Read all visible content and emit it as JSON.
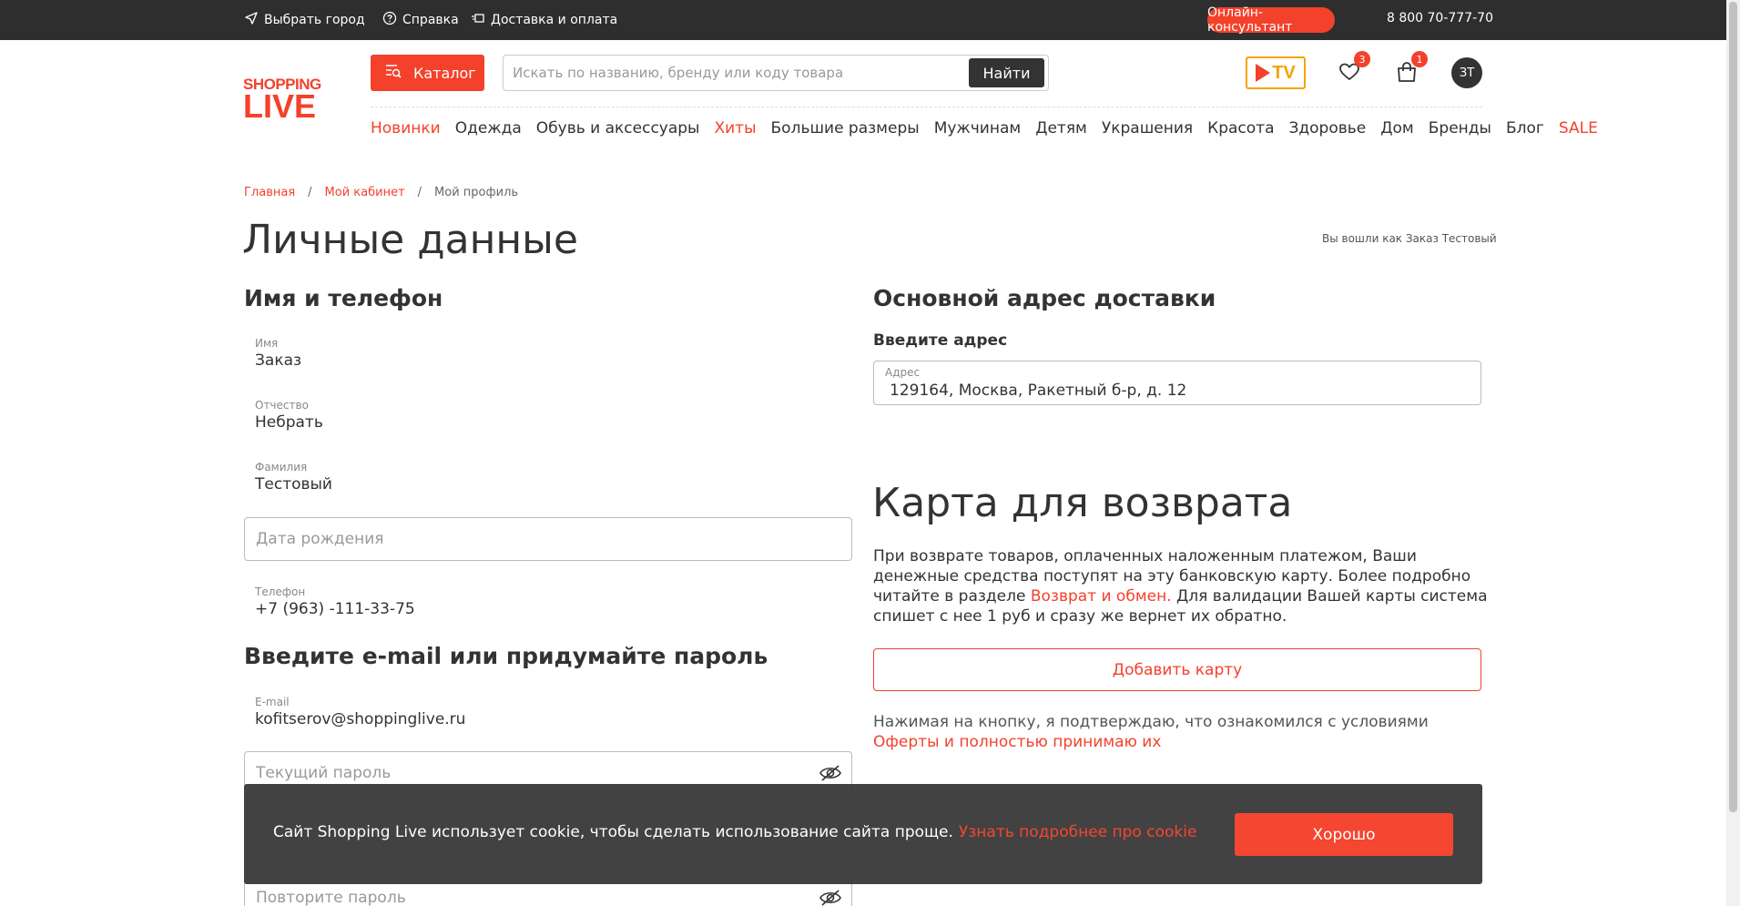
{
  "topbar": {
    "city_label": "Выбрать город",
    "help_label": "Справка",
    "delivery_label": "Доставка и оплата",
    "consultant_label": "Онлайн-консультант",
    "phone": "8 800 70-777-70"
  },
  "header": {
    "logo_top": "SHOPPING",
    "logo_bottom": "LIVE",
    "catalog_label": "Каталог",
    "search_placeholder": "Искать по названию, бренду или коду товара",
    "search_button": "Найти",
    "tv_label": "TV",
    "favorites_count": "3",
    "cart_count": "1",
    "avatar_initials": "ЗТ"
  },
  "nav": [
    {
      "label": "Новинки",
      "accent": true
    },
    {
      "label": "Одежда",
      "accent": false
    },
    {
      "label": "Обувь и аксессуары",
      "accent": false
    },
    {
      "label": "Хиты",
      "accent": true
    },
    {
      "label": "Большие размеры",
      "accent": false
    },
    {
      "label": "Мужчинам",
      "accent": false
    },
    {
      "label": "Детям",
      "accent": false
    },
    {
      "label": "Украшения",
      "accent": false
    },
    {
      "label": "Красота",
      "accent": false
    },
    {
      "label": "Здоровье",
      "accent": false
    },
    {
      "label": "Дом",
      "accent": false
    },
    {
      "label": "Бренды",
      "accent": false
    },
    {
      "label": "Блог",
      "accent": false
    },
    {
      "label": "SALE",
      "accent": true
    }
  ],
  "breadcrumb": {
    "home": "Главная",
    "cabinet": "Мой кабинет",
    "current": "Мой профиль",
    "separator": "/"
  },
  "page": {
    "title": "Личные данные",
    "logged_in": "Вы вошли как Заказ Тестовый"
  },
  "personal": {
    "heading": "Имя и телефон",
    "first_name_label": "Имя",
    "first_name": "Заказ",
    "patronymic_label": "Отчество",
    "patronymic": "Небрать",
    "last_name_label": "Фамилия",
    "last_name": "Тестовый",
    "birthdate_placeholder": "Дата рождения",
    "phone_label": "Телефон",
    "phone": "+7 (963) -111-33-75"
  },
  "credentials": {
    "heading": "Введите e-mail или придумайте пароль",
    "email_label": "E-mail",
    "email": "kofitserov@shoppinglive.ru",
    "current_password_placeholder": "Текущий пароль",
    "repeat_password_placeholder": "Повторите пароль"
  },
  "delivery": {
    "heading": "Основной адрес доставки",
    "subheading": "Введите адрес",
    "address_label": "Адрес",
    "address": "129164, Москва, Ракетный б-р, д. 12"
  },
  "refund_card": {
    "title": "Карта для возврата",
    "text_before": "При возврате товаров, оплаченных наложенным платежом, Ваши денежные средства поступят на эту банковскую карту. Более подробно читайте в разделе ",
    "text_link": "Возврат и обмен.",
    "text_after": " Для валидации Вашей карты система спишет с нее 1 руб и сразу же вернет их обратно.",
    "add_button": "Добавить карту",
    "terms_before": "Нажимая на кнопку, я подтверждаю, что ознакомился с условиями ",
    "terms_link": "Оферты и полностью принимаю их"
  },
  "cookie": {
    "message": "Сайт Shopping Live использует cookie, чтобы сделать использование сайта проще.",
    "link": "Узнать подробнее про cookie",
    "ok_button": "Хорошо"
  },
  "colors": {
    "accent": "#f4412b",
    "topbar_bg": "#2e2e2e",
    "tv_frame": "#f4a400"
  }
}
